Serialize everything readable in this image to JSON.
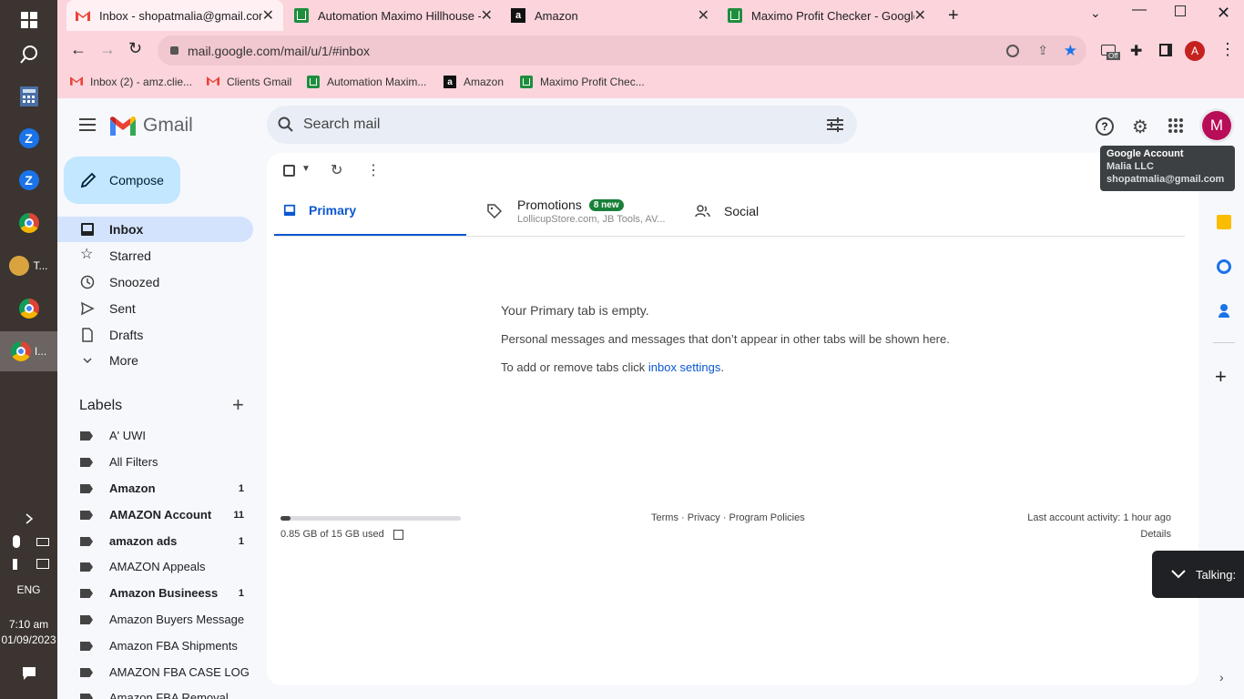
{
  "taskbar": {
    "items": [
      {
        "label": ""
      },
      {
        "label": "T..."
      },
      {
        "label": "I..."
      }
    ],
    "language": "ENG",
    "time": "7:10 am",
    "date": "01/09/2023"
  },
  "browser": {
    "tabs": [
      {
        "title": "Inbox - shopatmalia@gmail.com",
        "icon": "gmail-icon"
      },
      {
        "title": "Automation Maximo Hillhouse - ",
        "icon": "sheets-icon"
      },
      {
        "title": "Amazon",
        "icon": "amazon-icon"
      },
      {
        "title": "Maximo Profit Checker - Google",
        "icon": "sheets-icon"
      }
    ],
    "url": "mail.google.com/mail/u/1/#inbox",
    "extension_badge": "Off",
    "profile_initial": "A",
    "bookmarks": [
      {
        "label": "Inbox (2) - amz.clie...",
        "icon": "gmail-icon"
      },
      {
        "label": "Clients Gmail",
        "icon": "gmail-icon"
      },
      {
        "label": "Automation Maxim...",
        "icon": "sheets-icon"
      },
      {
        "label": "Amazon",
        "icon": "amazon-icon"
      },
      {
        "label": "Maximo Profit Chec...",
        "icon": "sheets-icon"
      }
    ]
  },
  "gmail": {
    "logo_text": "Gmail",
    "search_placeholder": "Search mail",
    "account_initial": "M",
    "tooltip": {
      "title": "Google Account",
      "name": "Malia LLC",
      "email": "shopatmalia@gmail.com"
    },
    "compose_label": "Compose",
    "nav": [
      {
        "label": "Inbox",
        "icon": "inbox-icon"
      },
      {
        "label": "Starred",
        "icon": "star-icon"
      },
      {
        "label": "Snoozed",
        "icon": "clock-icon"
      },
      {
        "label": "Sent",
        "icon": "send-icon"
      },
      {
        "label": "Drafts",
        "icon": "draft-icon"
      },
      {
        "label": "More",
        "icon": "chevron-down-icon"
      }
    ],
    "labels_heading": "Labels",
    "labels": [
      {
        "name": "A' UWI",
        "count": ""
      },
      {
        "name": "All Filters",
        "count": ""
      },
      {
        "name": "Amazon",
        "count": "1"
      },
      {
        "name": "AMAZON Account",
        "count": "11"
      },
      {
        "name": "amazon ads",
        "count": "1"
      },
      {
        "name": "AMAZON Appeals",
        "count": ""
      },
      {
        "name": "Amazon Busineess",
        "count": "1"
      },
      {
        "name": "Amazon Buyers Message",
        "count": ""
      },
      {
        "name": "Amazon FBA Shipments",
        "count": ""
      },
      {
        "name": "AMAZON FBA CASE LOG",
        "count": ""
      },
      {
        "name": "Amazon FBA Removal",
        "count": ""
      }
    ],
    "tabs": {
      "primary": "Primary",
      "promotions": "Promotions",
      "promotions_badge": "8 new",
      "promotions_sub": "LollicupStore.com, JB Tools, AV...",
      "social": "Social"
    },
    "empty": {
      "title": "Your Primary tab is empty.",
      "line1": "Personal messages and messages that don’t appear in other tabs will be shown here.",
      "line2_prefix": "To add or remove tabs click ",
      "line2_link": "inbox settings",
      "line2_suffix": "."
    },
    "footer": {
      "storage": "0.85 GB of 15 GB used",
      "storage_fraction": 0.057,
      "links": "Terms · Privacy · Program Policies",
      "activity": "Last account activity: 1 hour ago",
      "details": "Details"
    },
    "toast": "Talking:"
  },
  "colors": {
    "chrome_frame": "#fbd4dc",
    "compose_bg": "#c2e7ff",
    "active_nav": "#d3e3fd",
    "link": "#0b57d0",
    "avatar": "#b80e57"
  }
}
